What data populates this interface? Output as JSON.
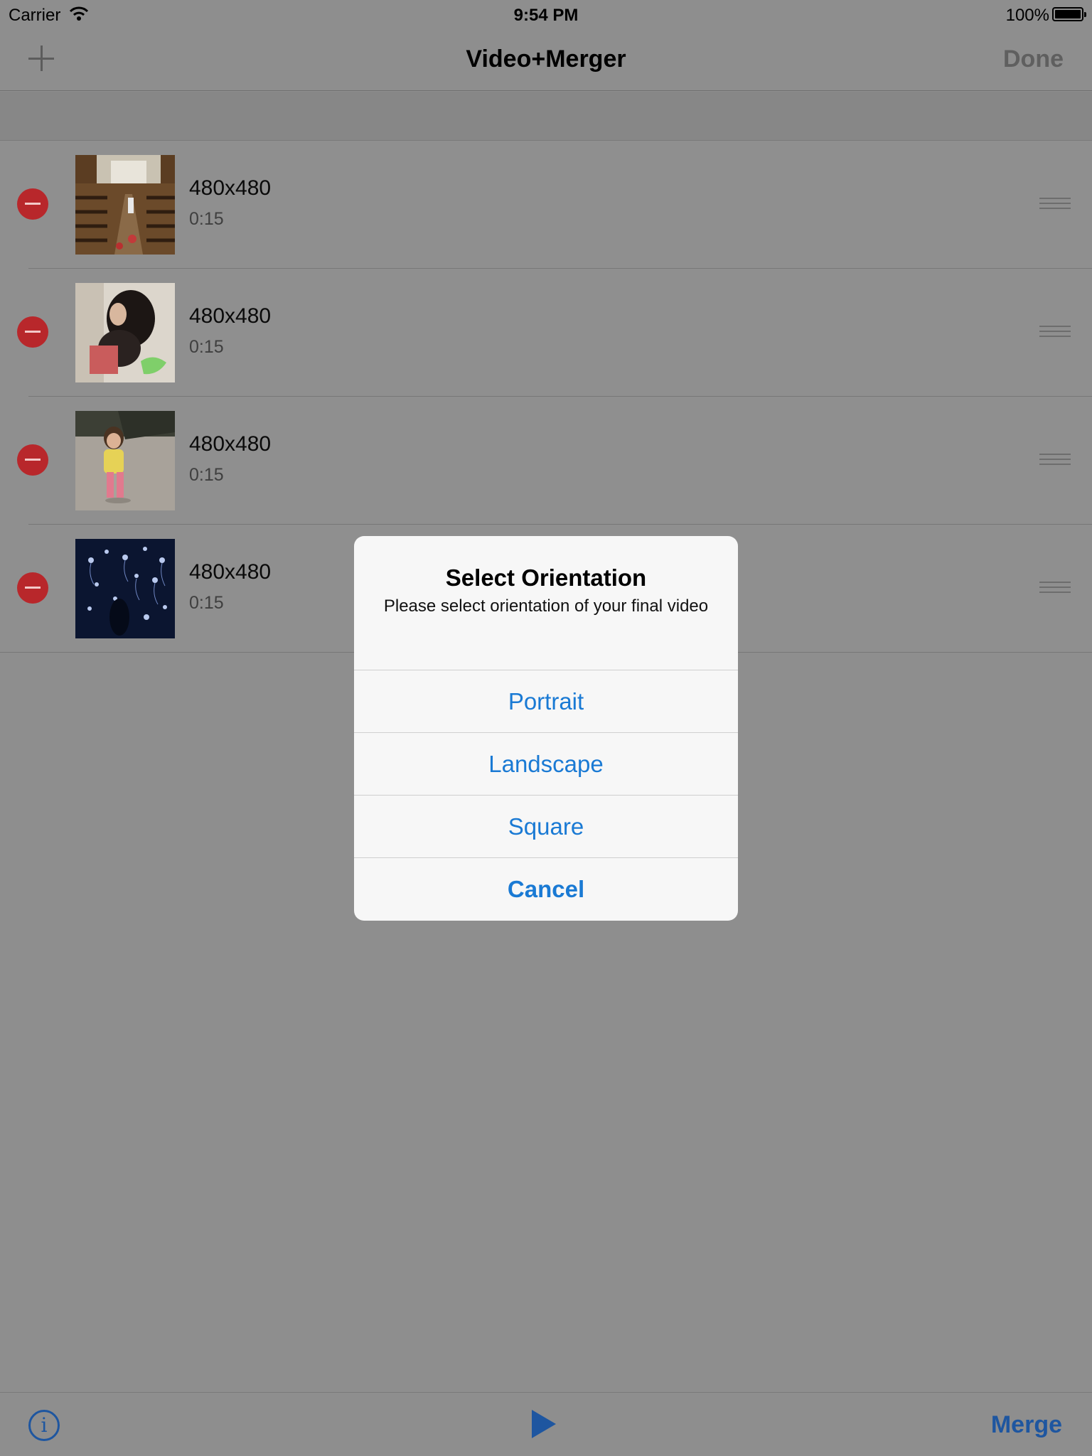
{
  "status_bar": {
    "carrier": "Carrier",
    "time": "9:54 PM",
    "battery_percent": "100%",
    "battery_level": 1.0
  },
  "nav_bar": {
    "add_icon": "plus-icon",
    "title": "Video+Merger",
    "done_label": "Done"
  },
  "videos": [
    {
      "resolution": "480x480",
      "duration": "0:15"
    },
    {
      "resolution": "480x480",
      "duration": "0:15"
    },
    {
      "resolution": "480x480",
      "duration": "0:15"
    },
    {
      "resolution": "480x480",
      "duration": "0:15"
    }
  ],
  "toolbar": {
    "info_icon": "info-icon",
    "info_glyph": "i",
    "play_icon": "play-icon",
    "merge_label": "Merge"
  },
  "alert": {
    "title": "Select Orientation",
    "message": "Please select orientation of your final video",
    "buttons": [
      "Portrait",
      "Landscape",
      "Square",
      "Cancel"
    ]
  },
  "colors": {
    "accent": "#1a7ad4",
    "toolbar_tint": "#1e56a0",
    "delete_red": "#b8272b"
  }
}
